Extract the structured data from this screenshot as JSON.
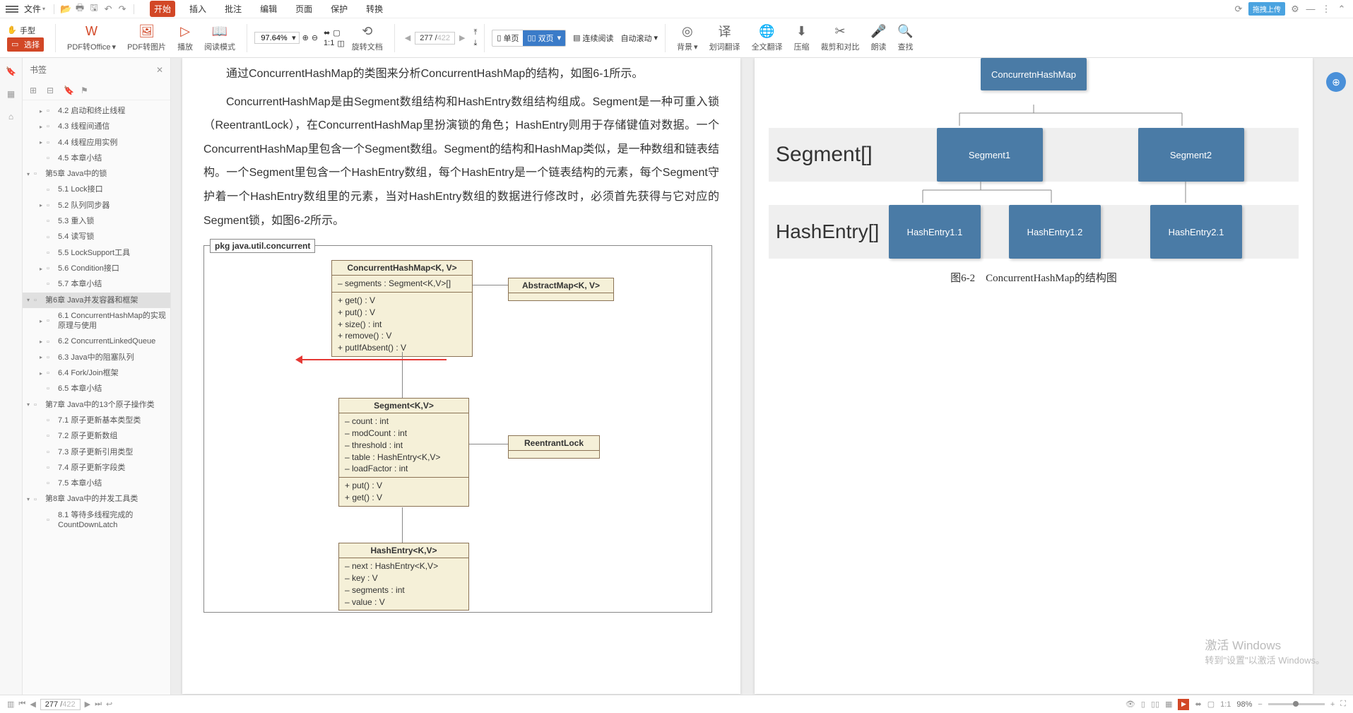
{
  "menubar": {
    "file": "文件",
    "tabs": [
      "开始",
      "插入",
      "批注",
      "编辑",
      "页面",
      "保护",
      "转换"
    ],
    "activeTab": 0,
    "dragUpload": "拖拽上传"
  },
  "ribbon": {
    "handTool": "手型",
    "selectTool": "选择",
    "pdfToOffice": "PDF转Office",
    "pdfToImage": "PDF转图片",
    "play": "播放",
    "readMode": "阅读模式",
    "zoom": "97.64%",
    "rotate": "旋转文档",
    "currentPage": "277",
    "totalPages": "422",
    "singlePage": "单页",
    "doublePage": "双页",
    "continuousRead": "连续阅读",
    "autoScroll": "自动滚动",
    "background": "背景",
    "wordTranslate": "划词翻译",
    "fullTranslate": "全文翻译",
    "compress": "压缩",
    "cropCompare": "裁剪和对比",
    "readAloud": "朗读",
    "find": "查找"
  },
  "sidebar": {
    "title": "书签",
    "items": [
      {
        "level": 1,
        "arr": "▸",
        "label": "4.2 启动和终止线程"
      },
      {
        "level": 1,
        "arr": "▸",
        "label": "4.3 线程间通信"
      },
      {
        "level": 1,
        "arr": "▸",
        "label": "4.4 线程应用实例"
      },
      {
        "level": 1,
        "arr": "",
        "label": "4.5 本章小结"
      },
      {
        "level": 0,
        "arr": "▾",
        "label": "第5章 Java中的锁"
      },
      {
        "level": 1,
        "arr": "",
        "label": "5.1 Lock接口"
      },
      {
        "level": 1,
        "arr": "▸",
        "label": "5.2 队列同步器"
      },
      {
        "level": 1,
        "arr": "",
        "label": "5.3 重入锁"
      },
      {
        "level": 1,
        "arr": "",
        "label": "5.4 读写锁"
      },
      {
        "level": 1,
        "arr": "",
        "label": "5.5 LockSupport工具"
      },
      {
        "level": 1,
        "arr": "▸",
        "label": "5.6 Condition接口"
      },
      {
        "level": 1,
        "arr": "",
        "label": "5.7 本章小结"
      },
      {
        "level": 0,
        "arr": "▾",
        "label": "第6章 Java并发容器和框架",
        "selected": true
      },
      {
        "level": 1,
        "arr": "▸",
        "label": "6.1 ConcurrentHashMap的实现原理与使用"
      },
      {
        "level": 1,
        "arr": "▸",
        "label": "6.2 ConcurrentLinkedQueue"
      },
      {
        "level": 1,
        "arr": "▸",
        "label": "6.3 Java中的阻塞队列"
      },
      {
        "level": 1,
        "arr": "▸",
        "label": "6.4 Fork/Join框架"
      },
      {
        "level": 1,
        "arr": "",
        "label": "6.5 本章小结"
      },
      {
        "level": 0,
        "arr": "▾",
        "label": "第7章 Java中的13个原子操作类"
      },
      {
        "level": 1,
        "arr": "",
        "label": "7.1 原子更新基本类型类"
      },
      {
        "level": 1,
        "arr": "",
        "label": "7.2 原子更新数组"
      },
      {
        "level": 1,
        "arr": "",
        "label": "7.3 原子更新引用类型"
      },
      {
        "level": 1,
        "arr": "",
        "label": "7.4 原子更新字段类"
      },
      {
        "level": 1,
        "arr": "",
        "label": "7.5 本章小结"
      },
      {
        "level": 0,
        "arr": "▾",
        "label": "第8章 Java中的并发工具类"
      },
      {
        "level": 1,
        "arr": "",
        "label": "8.1 等待多线程完成的CountDownLatch"
      }
    ]
  },
  "page1": {
    "para1": "通过ConcurrentHashMap的类图来分析ConcurrentHashMap的结构，如图6-1所示。",
    "para2": "ConcurrentHashMap是由Segment数组结构和HashEntry数组结构组成。Segment是一种可重入锁（ReentrantLock），在ConcurrentHashMap里扮演锁的角色；HashEntry则用于存储键值对数据。一个ConcurrentHashMap里包含一个Segment数组。Segment的结构和HashMap类似，是一种数组和链表结构。一个Segment里包含一个HashEntry数组，每个HashEntry是一个链表结构的元素，每个Segment守护着一个HashEntry数组里的元素，当对HashEntry数组的数据进行修改时，必须首先获得与它对应的Segment锁，如图6-2所示。",
    "umlPkg": "pkg java.util.concurrent",
    "uml": {
      "chm": {
        "name": "ConcurrentHashMap<K, V>",
        "attrs": "– segments : Segment<K,V>[]",
        "ops": "+ get() : V\n+ put() : V\n+ size() : int\n+ remove() : V\n+ putIfAbsent() : V"
      },
      "abstract": {
        "name": "AbstractMap<K, V>"
      },
      "segment": {
        "name": "Segment<K,V>",
        "attrs": "– count : int\n– modCount : int\n– threshold : int\n– table : HashEntry<K,V>\n– loadFactor : int",
        "ops": "+ put() : V\n+ get() : V"
      },
      "reentrant": {
        "name": "ReentrantLock"
      },
      "hashentry": {
        "name": "HashEntry<K,V>",
        "attrs": "– next : HashEntry<K,V>\n– key : V\n– segments : int\n– value : V"
      }
    }
  },
  "page2": {
    "topBox": "ConcurretnHashMap",
    "segLabel": "Segment[]",
    "seg1": "Segment1",
    "seg2": "Segment2",
    "heLabel": "HashEntry[]",
    "he11": "HashEntry1.1",
    "he12": "HashEntry1.2",
    "he21": "HashEntry2.1",
    "caption": "图6-2　ConcurrentHashMap的结构图"
  },
  "watermark": {
    "line1": "激活 Windows",
    "line2": "转到\"设置\"以激活 Windows。"
  },
  "statusbar": {
    "curPage": "277",
    "totalPages": "422",
    "zoom": "98%"
  }
}
